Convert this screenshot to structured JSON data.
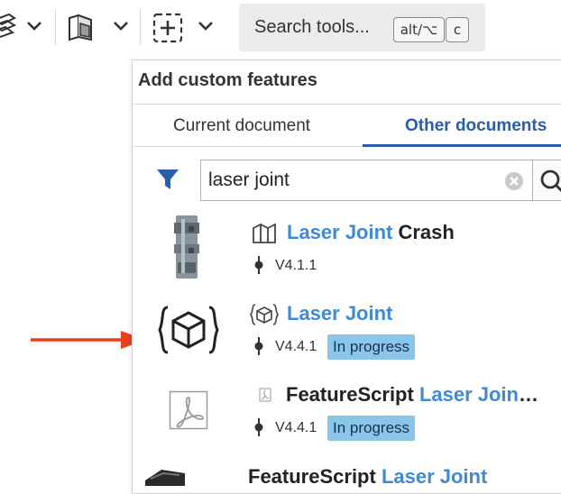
{
  "toolbar": {
    "search_tools": {
      "label": "Search tools...",
      "shortcut_1": "alt/⌥",
      "shortcut_2": "c"
    }
  },
  "panel": {
    "title": "Add custom features",
    "tabs": [
      {
        "label": "Current document",
        "active": false
      },
      {
        "label": "Other documents",
        "active": true
      }
    ],
    "filter": {
      "value": "laser joint"
    },
    "results": [
      {
        "name_highlight": "Laser Joint",
        "name_rest": " Crash",
        "version": "V4.1.1",
        "status": "",
        "icon": "part-studio-icon",
        "thumbnail": "part-render-thumbnail"
      },
      {
        "name_highlight": "Laser Joint",
        "name_rest": "",
        "version": "V4.4.1",
        "status": "In progress",
        "icon": "custom-feature-icon",
        "thumbnail": "custom-feature-thumbnail"
      },
      {
        "name_prefix": "FeatureScript ",
        "name_highlight": "Laser Join",
        "name_rest": "…",
        "version": "V4.4.1",
        "status": "In progress",
        "icon": "pdf-icon",
        "thumbnail": "pdf-thumbnail"
      },
      {
        "name_prefix": "FeatureScript ",
        "name_highlight": "Laser Joint",
        "name_rest": "",
        "version": "",
        "status": "",
        "icon": "",
        "thumbnail": "part-render-thumbnail"
      }
    ]
  },
  "annotation": {
    "arrow_color": "#e8401c"
  },
  "colors": {
    "accent": "#2a5ea7",
    "highlight": "#3f8ad4",
    "badge": "#8bc5ea"
  }
}
